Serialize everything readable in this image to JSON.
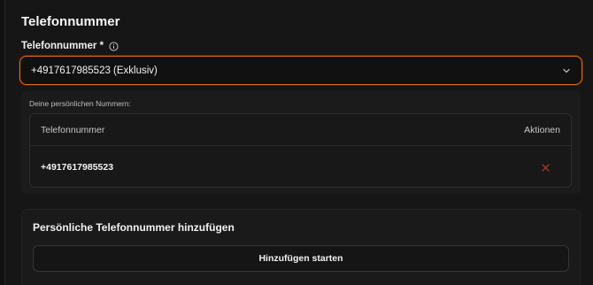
{
  "section": {
    "title": "Telefonnummer"
  },
  "phone_field": {
    "label": "Telefonnummer *",
    "info_icon": "info-circle-icon",
    "selected_value": "+4917617985523 (Exklusiv)",
    "accent_color": "#e86a1f"
  },
  "personal_numbers": {
    "title": "Deine persönlichen Nummern:",
    "columns": [
      "Telefonnummer",
      "Aktionen"
    ],
    "rows": [
      {
        "number": "+4917617985523",
        "action_icon": "delete-x-icon"
      }
    ],
    "delete_color": "#c0392b"
  },
  "add_section": {
    "title": "Persönliche Telefonnummer hinzufügen",
    "button_label": "Hinzufügen starten"
  }
}
